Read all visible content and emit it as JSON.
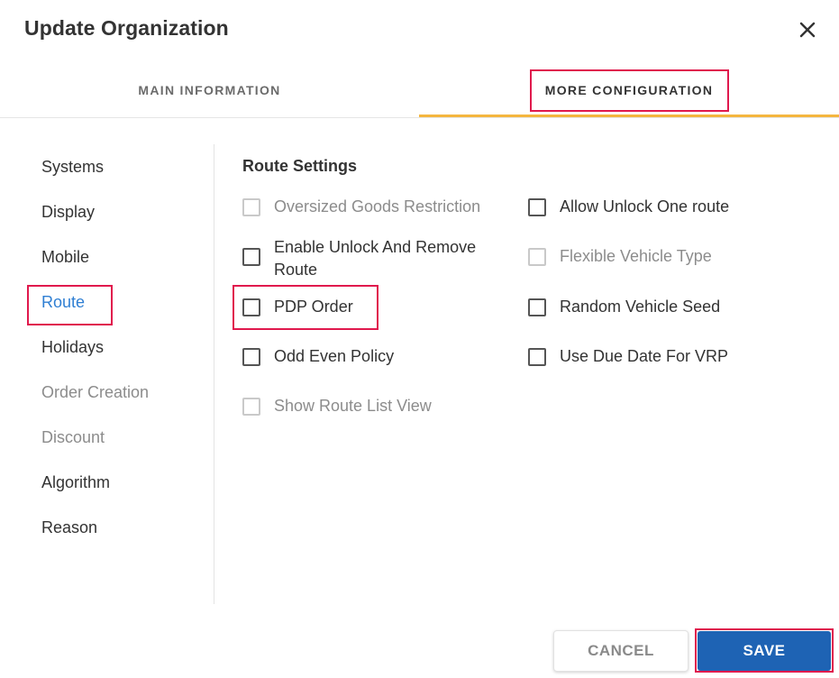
{
  "dialog": {
    "title": "Update Organization",
    "close_icon": "close-icon"
  },
  "tabs": [
    {
      "label": "MAIN INFORMATION",
      "active": false
    },
    {
      "label": "MORE CONFIGURATION",
      "active": true
    }
  ],
  "sidebar": {
    "items": [
      {
        "label": "Systems",
        "state": "normal"
      },
      {
        "label": "Display",
        "state": "normal"
      },
      {
        "label": "Mobile",
        "state": "normal"
      },
      {
        "label": "Route",
        "state": "active"
      },
      {
        "label": "Holidays",
        "state": "normal"
      },
      {
        "label": "Order Creation",
        "state": "disabled"
      },
      {
        "label": "Discount",
        "state": "disabled"
      },
      {
        "label": "Algorithm",
        "state": "normal"
      },
      {
        "label": "Reason",
        "state": "normal"
      }
    ]
  },
  "route_settings": {
    "title": "Route Settings",
    "left_column": [
      {
        "label": "Oversized Goods Restriction",
        "checked": false,
        "disabled": true
      },
      {
        "label": "Enable Unlock And Remove Route",
        "checked": false,
        "disabled": false
      },
      {
        "label": "PDP Order",
        "checked": false,
        "disabled": false
      },
      {
        "label": "Odd Even Policy",
        "checked": false,
        "disabled": false
      },
      {
        "label": "Show Route List View",
        "checked": false,
        "disabled": true
      }
    ],
    "right_column": [
      {
        "label": "Allow Unlock One route",
        "checked": false,
        "disabled": false
      },
      {
        "label": "Flexible Vehicle Type",
        "checked": false,
        "disabled": true
      },
      {
        "label": "Random Vehicle Seed",
        "checked": false,
        "disabled": false
      },
      {
        "label": "Use Due Date For VRP",
        "checked": false,
        "disabled": false
      }
    ]
  },
  "footer": {
    "cancel_label": "CANCEL",
    "save_label": "SAVE"
  },
  "colors": {
    "accent_tab": "#f4b63f",
    "active_link": "#2f7fd3",
    "primary_button": "#1e63b4",
    "highlight_box": "#e0194d"
  }
}
